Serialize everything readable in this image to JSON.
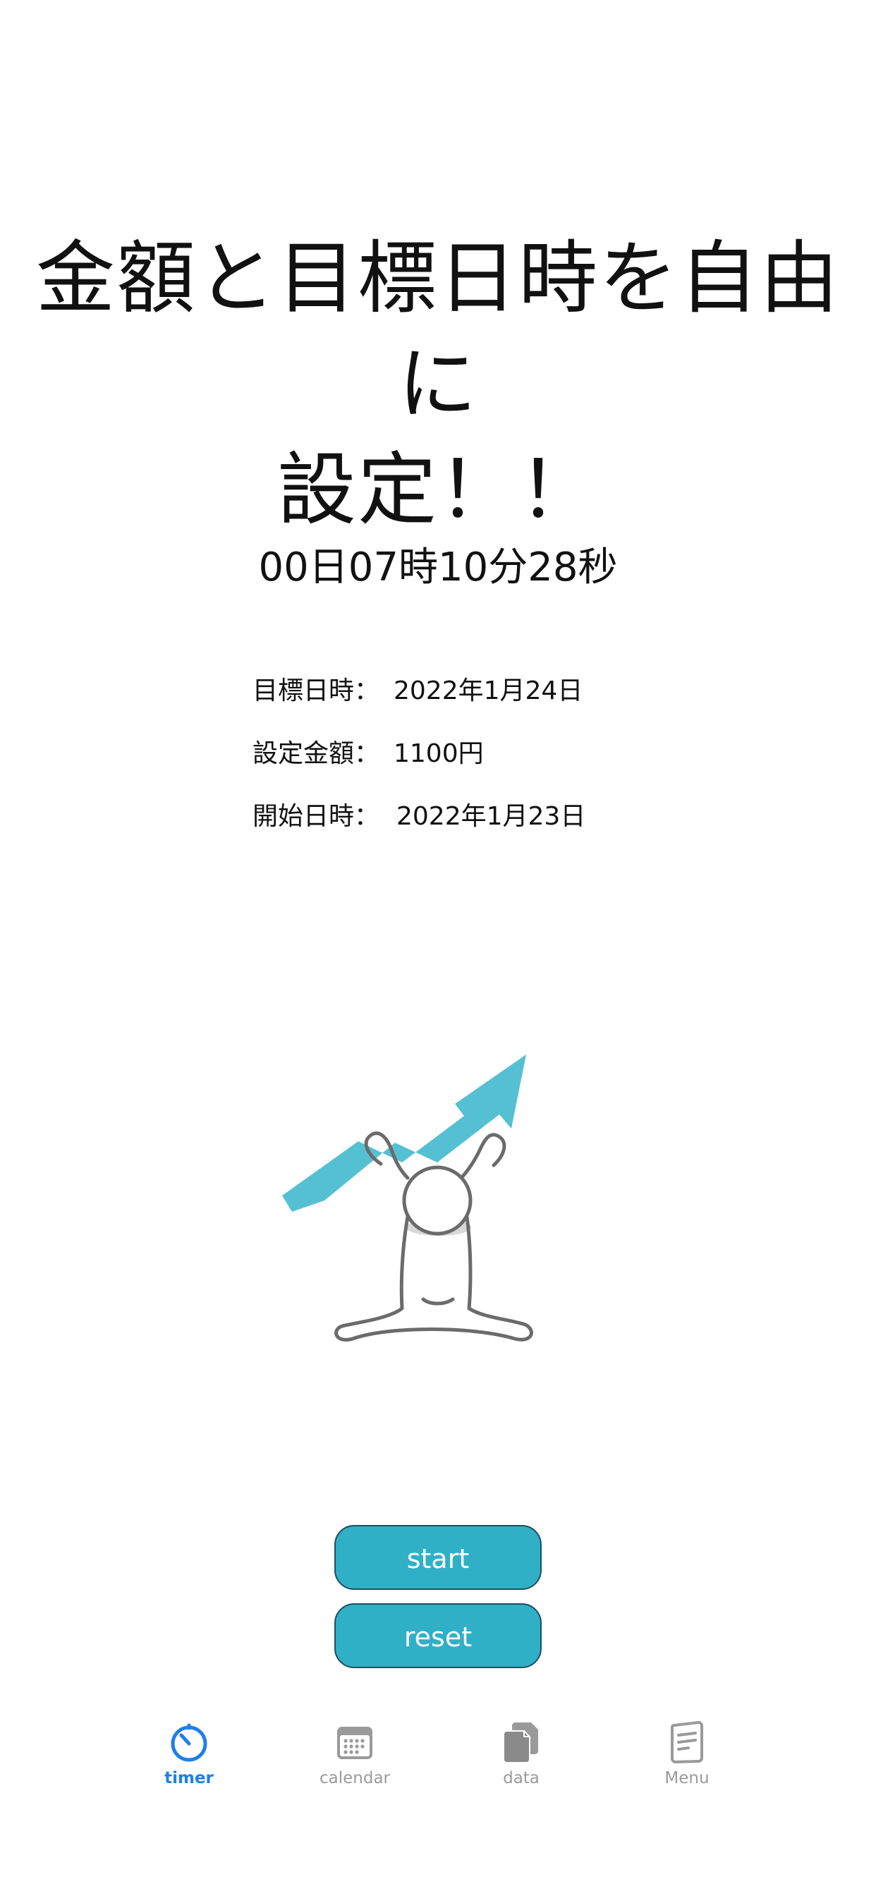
{
  "title": {
    "line1": "金額と目標日時を自由に",
    "line2": "設定！！"
  },
  "countdown": "00日07時10分28秒",
  "info": {
    "target_label": "目標日時：",
    "target_value": "2022年1月24日",
    "amount_label": "設定金額：",
    "amount_value": "1100円",
    "start_label": "開始日時：",
    "start_value": "2022年1月23日"
  },
  "buttons": {
    "start_label": "start",
    "reset_label": "reset"
  },
  "tabbar": {
    "tabs": [
      {
        "label": "timer",
        "icon": "timer-icon",
        "active": true
      },
      {
        "label": "calendar",
        "icon": "calendar-icon",
        "active": false
      },
      {
        "label": "data",
        "icon": "documents-icon",
        "active": false
      },
      {
        "label": "Menu",
        "icon": "menu-book-icon",
        "active": false
      }
    ]
  },
  "colors": {
    "button_fill": "#30b0c7",
    "button_border": "#1d4f5e",
    "tab_active": "#1e7fe8",
    "tab_inactive": "#9a9a9a",
    "arrow": "#4dbdd1"
  },
  "illustration": "person-with-rising-arrow-illustration"
}
